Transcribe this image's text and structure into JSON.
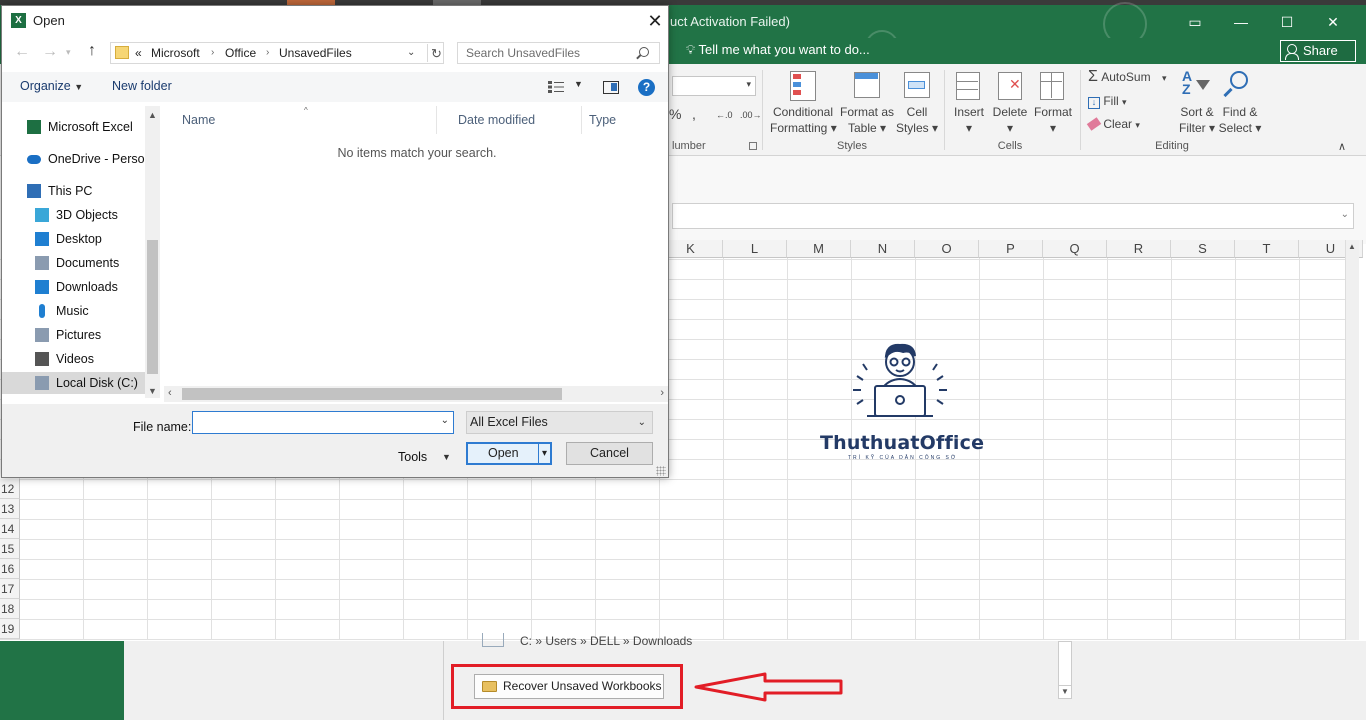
{
  "excel": {
    "title_partial": "uct Activation Failed)",
    "tell_me": "Tell me what you want to do...",
    "share": "Share",
    "number_group": "Number",
    "number_partial": "lumber",
    "ribbon": {
      "conditional_formatting": [
        "Conditional",
        "Formatting"
      ],
      "format_as_table": [
        "Format as",
        "Table"
      ],
      "cell_styles": [
        "Cell",
        "Styles"
      ],
      "styles_group": "Styles",
      "insert": "Insert",
      "delete": "Delete",
      "format": "Format",
      "cells_group": "Cells",
      "autosum": "AutoSum",
      "fill": "Fill",
      "clear": "Clear",
      "sort_filter": [
        "Sort &",
        "Filter"
      ],
      "find_select": [
        "Find &",
        "Select"
      ],
      "editing_group": "Editing"
    },
    "columns": [
      "K",
      "L",
      "M",
      "N",
      "O",
      "P",
      "Q",
      "R",
      "S",
      "T",
      "U"
    ],
    "rows": [
      "12",
      "13",
      "14",
      "15",
      "16",
      "17",
      "18",
      "19"
    ],
    "backstage_path": "C: » Users » DELL » Downloads",
    "recover_button": "Recover Unsaved Workbooks"
  },
  "logo": {
    "name": "ThuthuatOffice",
    "tagline": "TRÍ KỸ CỦA DÂN CÔNG SỞ"
  },
  "dialog": {
    "title": "Open",
    "address": {
      "prefix": "«",
      "segments": [
        "Microsoft",
        "Office",
        "UnsavedFiles"
      ]
    },
    "search_placeholder": "Search UnsavedFiles",
    "organize": "Organize",
    "new_folder": "New folder",
    "nav_items": [
      {
        "label": "Microsoft Excel",
        "icon": "excel-icon"
      },
      {
        "label": "OneDrive - Person",
        "icon": "cloud-icon"
      },
      {
        "label": "This PC",
        "icon": "computer-icon"
      },
      {
        "label": "3D Objects",
        "icon": "cube-icon"
      },
      {
        "label": "Desktop",
        "icon": "desktop-icon"
      },
      {
        "label": "Documents",
        "icon": "document-icon"
      },
      {
        "label": "Downloads",
        "icon": "download-icon"
      },
      {
        "label": "Music",
        "icon": "music-icon"
      },
      {
        "label": "Pictures",
        "icon": "pictures-icon"
      },
      {
        "label": "Videos",
        "icon": "video-icon"
      },
      {
        "label": "Local Disk (C:)",
        "icon": "drive-icon",
        "selected": true
      }
    ],
    "columns": [
      "Name",
      "Date modified",
      "Type"
    ],
    "empty_message": "No items match your search.",
    "file_name_label": "File name:",
    "file_name_value": "",
    "file_type": "All Excel Files",
    "tools": "Tools",
    "open": "Open",
    "cancel": "Cancel"
  },
  "colors": {
    "excel_green": "#217346",
    "highlight_red": "#e21d26",
    "accent_blue": "#2e7bd1"
  }
}
